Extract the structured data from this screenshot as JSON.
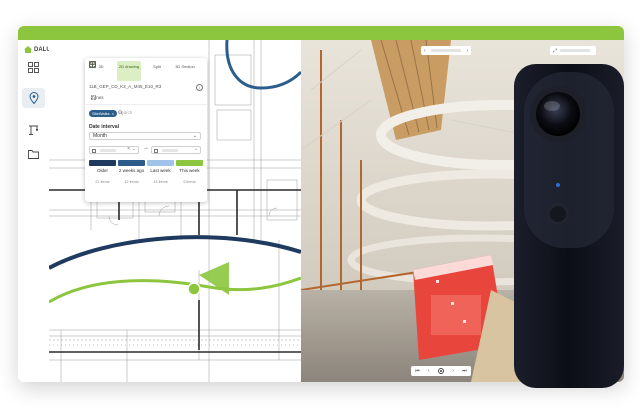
{
  "app": {
    "logo_text": "DALUX"
  },
  "rail": {
    "items": [
      {
        "name": "apps-grid-icon",
        "active": false
      },
      {
        "name": "map-pin-icon",
        "active": true
      },
      {
        "name": "crane-icon",
        "active": false
      },
      {
        "name": "folder-icon",
        "active": false
      }
    ]
  },
  "panel": {
    "modes": [
      {
        "label": "3D",
        "icon": "cube-icon",
        "active": false
      },
      {
        "label": "2D drawing",
        "icon": "drawing-icon",
        "active": true
      },
      {
        "label": "Split",
        "icon": "split-icon",
        "active": false
      },
      {
        "label": "3D Section",
        "icon": "section-icon",
        "active": false
      }
    ],
    "file_name": "11B_GEP_CD_K3_A_M45_E10_R3",
    "zones_label": "Zones",
    "filter_chip": "SiteWalks",
    "search_placeholder": "Search",
    "date_interval_label": "Date interval",
    "date_interval_value": "Month",
    "legend": [
      {
        "label": "Older",
        "count": "21 items",
        "color": "#1e3a5f"
      },
      {
        "label": "2 weeks ago",
        "count": "12 items",
        "color": "#2e5c8a"
      },
      {
        "label": "Last week",
        "count": "13 items",
        "color": "#9fc3ea"
      },
      {
        "label": "This week",
        "count": "9 items",
        "color": "#8cc63f"
      }
    ]
  },
  "colors": {
    "brand_green": "#8cc63f",
    "path_navy": "#1e3a5f",
    "camera_body": "#11131c"
  }
}
